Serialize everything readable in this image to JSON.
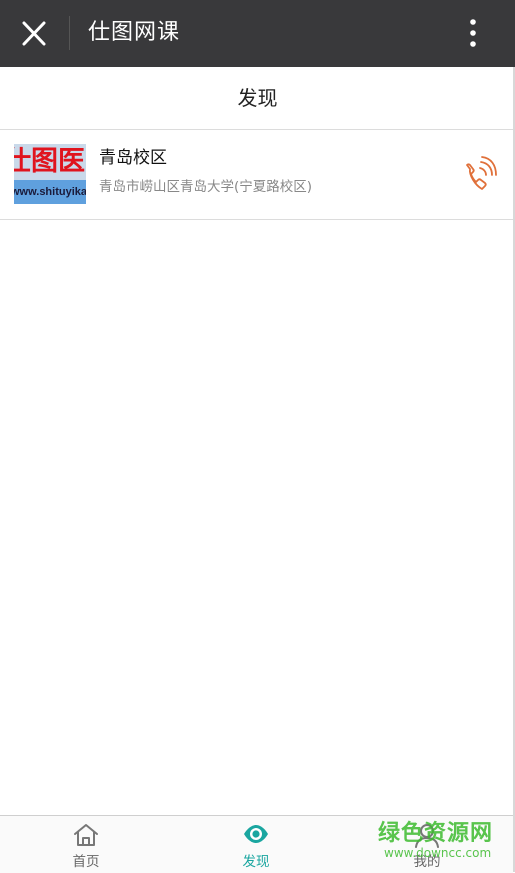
{
  "topbar": {
    "title": "仕图网课",
    "close_icon": "close-icon",
    "more_icon": "more-vertical-icon"
  },
  "page": {
    "title": "发现"
  },
  "list": {
    "items": [
      {
        "title": "青岛校区",
        "address": "青岛市崂山区青岛大学(宁夏路校区)",
        "thumbnail_text_top": "仕图医",
        "thumbnail_text_bottom": "www.shituyikao.com",
        "action_icon": "phone-icon"
      }
    ]
  },
  "tabbar": {
    "tabs": [
      {
        "label": "首页",
        "icon": "home-icon",
        "active": false
      },
      {
        "label": "发现",
        "icon": "eye-icon",
        "active": true
      },
      {
        "label": "我的",
        "icon": "user-icon",
        "active": false
      }
    ]
  },
  "watermark": {
    "main": "绿色资源网",
    "sub": "www.downcc.com"
  },
  "colors": {
    "topbar_bg": "#39393b",
    "accent_teal": "#1aa6a0",
    "phone_orange": "#e0703a",
    "watermark_green": "#3dbb2f"
  }
}
